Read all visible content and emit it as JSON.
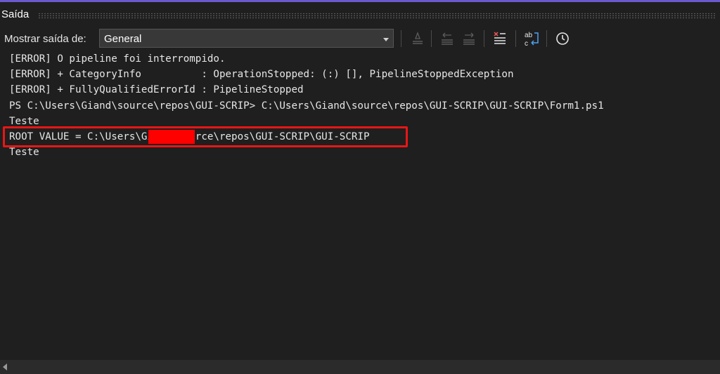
{
  "panel": {
    "title": "Saída"
  },
  "toolbar": {
    "source_label": "Mostrar saída de:",
    "source_selected": "General",
    "buttons": [
      {
        "icon": "find-message-icon"
      },
      {
        "icon": "previous-message-icon"
      },
      {
        "icon": "next-message-icon"
      },
      {
        "icon": "clear-all-icon"
      },
      {
        "icon": "word-wrap-icon"
      },
      {
        "icon": "timestamp-icon"
      }
    ]
  },
  "output": {
    "lines": [
      "[ERROR] O pipeline foi interrompido.",
      "[ERROR] + CategoryInfo          : OperationStopped: (:) [], PipelineStoppedException",
      "[ERROR] + FullyQualifiedErrorId : PipelineStopped",
      "PS C:\\Users\\Giand\\source\\repos\\GUI-SCRIP> C:\\Users\\Giand\\source\\repos\\GUI-SCRIP\\GUI-SCRIP\\Form1.ps1",
      "Teste",
      "ROOT VALUE = C:\\Users\\Giand\\source\\repos\\GUI-SCRIP\\GUI-SCRIP",
      "Teste"
    ]
  },
  "colors": {
    "background": "#1f1f1f",
    "accent": "#6a5acd",
    "highlight": "#e81616",
    "redaction": "#ff0000"
  }
}
